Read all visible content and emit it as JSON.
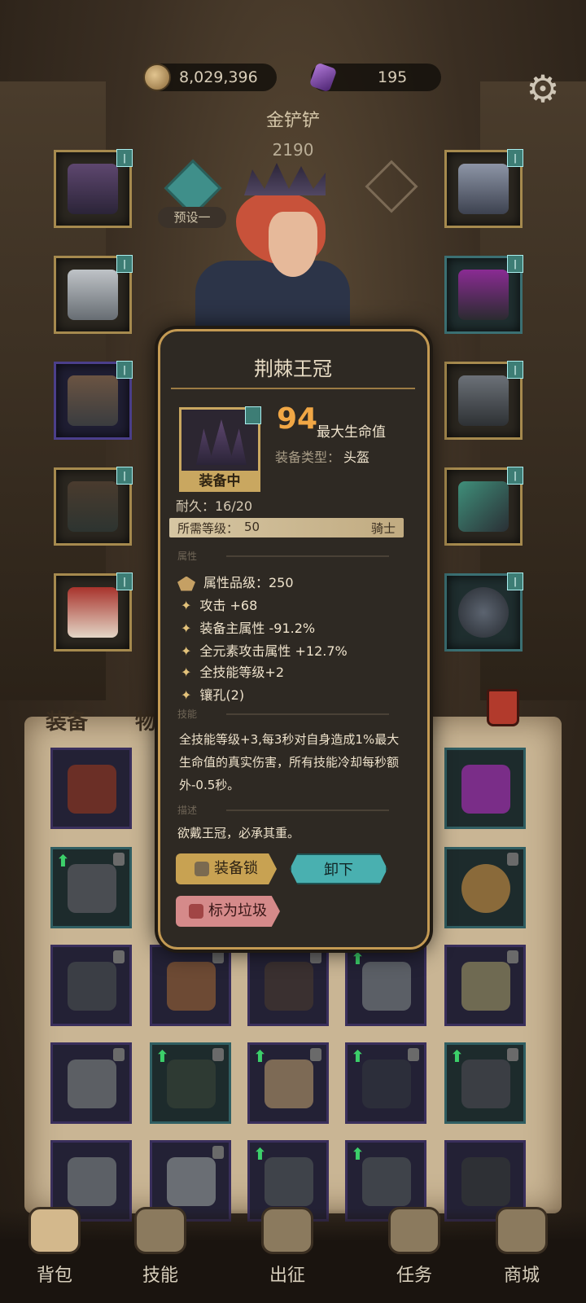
{
  "currency": {
    "gold": "8,029,396",
    "gems": "195"
  },
  "player": {
    "name": "金铲铲",
    "power": "2190",
    "preset_label": "预设一"
  },
  "tabs": {
    "equip": "装备",
    "items": "物品"
  },
  "popup": {
    "title": "荆棘王冠",
    "equipped": "装备中",
    "main_value": "94",
    "main_stat": "最大生命值",
    "type_key": "装备类型：",
    "type_value": "头盔",
    "durability": "耐久：16/20",
    "req_label": "所需等级：",
    "req_level": "50",
    "req_class": "骑士",
    "section_attr": "属性",
    "attr_grade": "属性品级：250",
    "attrs": [
      "攻击 +68",
      "装备主属性 -91.2%",
      "全元素攻击属性 +12.7%",
      "全技能等级+2",
      "镶孔(2)"
    ],
    "section_skill": "技能",
    "skill_text": "全技能等级+3,每3秒对自身造成1%最大生命值的真实伤害，所有技能冷却每秒额外-0.5秒。",
    "section_desc": "描述",
    "desc_text": "欲戴王冠，必承其重。",
    "btn_lock": "装备锁",
    "btn_unequip": "卸下",
    "btn_trash": "标为垃圾"
  },
  "nav": [
    "背包",
    "技能",
    "出征",
    "任务",
    "商城"
  ],
  "colors": {
    "accent_gold": "#c49a53",
    "teal": "#49b0b0",
    "stat_orange": "#f1a745",
    "upgrade_green": "#3ccf6a"
  }
}
